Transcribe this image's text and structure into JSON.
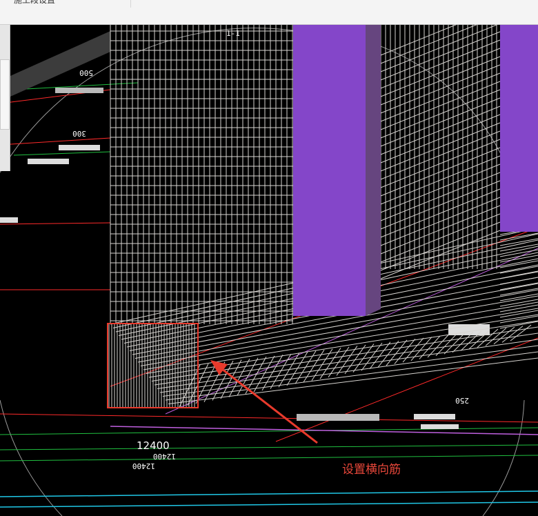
{
  "window": {
    "tab_label": "施工段设置"
  },
  "viewport": {
    "background": "#000000"
  },
  "scene": {
    "mesh_color": "#d9d6d2",
    "column_color": "#8446c9",
    "column_shade": "#66457f",
    "gridline_red": "#ff2a2a",
    "gridline_green": "#20c040",
    "gridline_cyan": "#20c8e8",
    "gridline_magenta": "#c060e0"
  },
  "dimension": {
    "value": "12400"
  },
  "annotation": {
    "text": "设置横向筋",
    "color": "#e8473a"
  }
}
